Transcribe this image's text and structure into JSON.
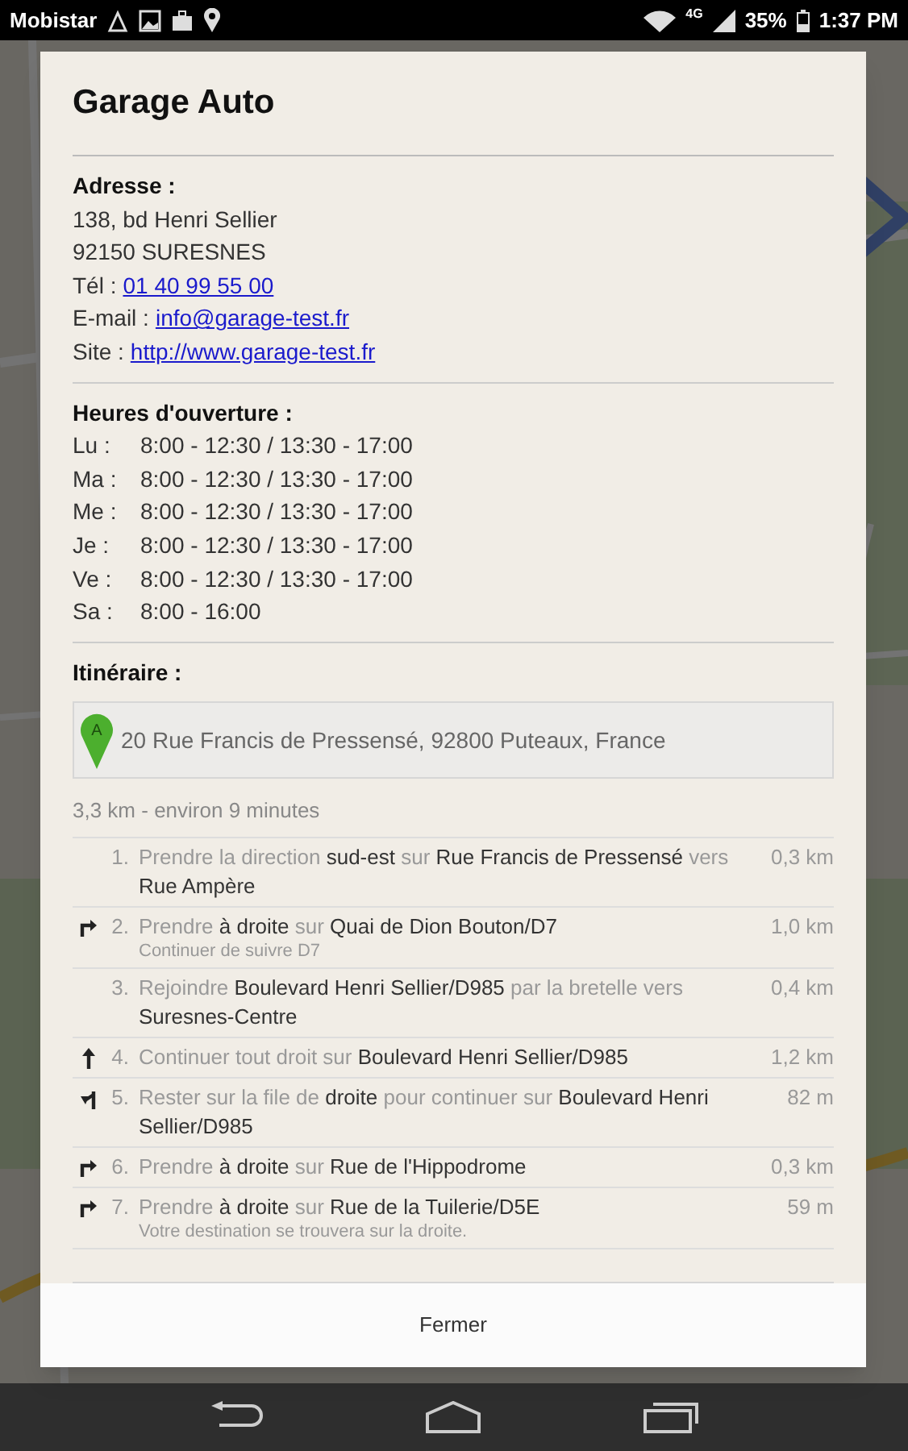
{
  "status_bar": {
    "carrier": "Mobistar",
    "network": "4G",
    "battery": "35%",
    "time": "1:37 PM"
  },
  "dialog": {
    "title": "Garage Auto",
    "address": {
      "heading": "Adresse :",
      "lines": [
        "138, bd Henri Sellier",
        "92150 SURESNES"
      ],
      "contacts": [
        {
          "label": "Tél :",
          "link": "01 40 99 55 00"
        },
        {
          "label": "E-mail :",
          "link": "info@garage-test.fr"
        },
        {
          "label": "Site :",
          "link": "http://www.garage-test.fr"
        }
      ]
    },
    "hours": {
      "heading": "Heures d'ouverture :",
      "days": [
        {
          "day": "Lu :",
          "time": "8:00 - 12:30 / 13:30 - 17:00"
        },
        {
          "day": "Ma :",
          "time": "8:00 - 12:30 / 13:30 - 17:00"
        },
        {
          "day": "Me :",
          "time": "8:00 - 12:30 / 13:30 - 17:00"
        },
        {
          "day": "Je :",
          "time": "8:00 - 12:30 / 13:30 - 17:00"
        },
        {
          "day": "Ve :",
          "time": "8:00 - 12:30 / 13:30 - 17:00"
        },
        {
          "day": "Sa :",
          "time": "8:00 - 16:00"
        }
      ]
    },
    "route": {
      "heading": "Itinéraire :",
      "start": {
        "marker": "A",
        "address": "20 Rue Francis de Pressensé, 92800 Puteaux, France"
      },
      "summary": "3,3 km - environ 9 minutes",
      "steps": [
        {
          "kind": "none",
          "number": "1.",
          "text": "Prendre la direction **sud-est** sur **Rue Francis de Pressensé** vers **Rue Ampère**",
          "distance": "0,3 km"
        },
        {
          "kind": "turn-right",
          "number": "2.",
          "text": "Prendre **à droite** sur **Quai de Dion Bouton/D7**",
          "note": "Continuer de suivre D7",
          "distance": "1,0 km"
        },
        {
          "kind": "none",
          "number": "3.",
          "text": "Rejoindre **Boulevard Henri Sellier/D985** par la bretelle vers **Suresnes-Centre**",
          "distance": "0,4 km"
        },
        {
          "kind": "straight",
          "number": "4.",
          "text": "Continuer tout droit sur **Boulevard Henri Sellier/D985**",
          "distance": "1,2 km"
        },
        {
          "kind": "keep-right",
          "number": "5.",
          "text": "Rester sur la file de **droite** pour continuer sur **Boulevard Henri Sellier/D985**",
          "distance": "82 m"
        },
        {
          "kind": "turn-right",
          "number": "6.",
          "text": "Prendre **à droite** sur **Rue de l'Hippodrome**",
          "distance": "0,3 km"
        },
        {
          "kind": "turn-right",
          "number": "7.",
          "text": "Prendre **à droite** sur **Rue de la Tuilerie/D5E**",
          "note": "Votre destination se trouvera sur la droite.",
          "distance": "59 m"
        }
      ]
    },
    "close_button": "Fermer"
  }
}
